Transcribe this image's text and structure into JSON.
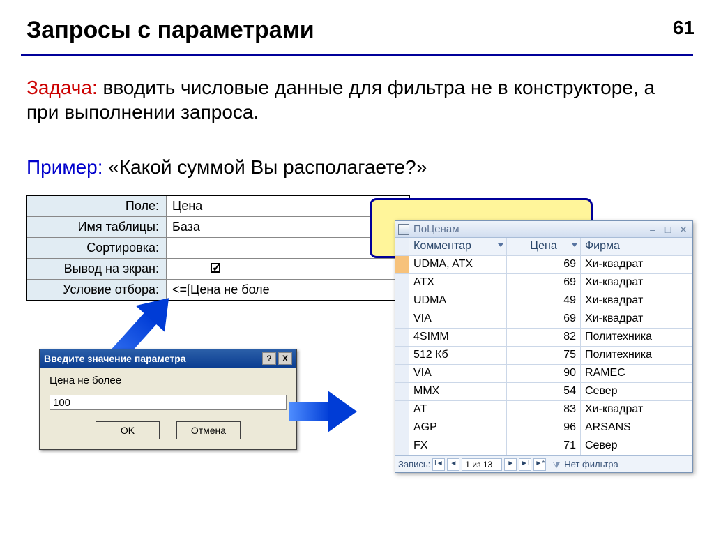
{
  "page_number": "61",
  "title": "Запросы с параметрами",
  "task_label": "Задача:",
  "task_text": " вводить числовые данные для фильтра не в конструкторе, а при выполнении запроса.",
  "example_label": "Пример:",
  "example_text": " «Какой суммой Вы располагаете?»",
  "query_grid": {
    "labels": {
      "field": "Поле:",
      "table": "Имя таблицы:",
      "sort": "Сортировка:",
      "show": "Вывод на экран:",
      "criteria": "Условие отбора:"
    },
    "values": {
      "field": "Цена",
      "table": "База",
      "sort": "",
      "criteria": "<=[Цена не боле"
    }
  },
  "dialog": {
    "title": "Введите значение параметра",
    "help_btn": "?",
    "close_btn": "X",
    "prompt": "Цена не более",
    "value": "100",
    "ok": "OK",
    "cancel": "Отмена"
  },
  "result": {
    "window_title": "ПоЦенам",
    "columns": [
      "Комментар",
      "Цена",
      "Фирма"
    ],
    "rows": [
      {
        "c1": "UDMA, ATX",
        "c2": "69",
        "c3": "Хи-квадрат"
      },
      {
        "c1": "ATX",
        "c2": "69",
        "c3": "Хи-квадрат"
      },
      {
        "c1": "UDMA",
        "c2": "49",
        "c3": "Хи-квадрат"
      },
      {
        "c1": "VIA",
        "c2": "69",
        "c3": "Хи-квадрат"
      },
      {
        "c1": "4SIMM",
        "c2": "82",
        "c3": "Политехника"
      },
      {
        "c1": "512 Кб",
        "c2": "75",
        "c3": "Политехника"
      },
      {
        "c1": "VIA",
        "c2": "90",
        "c3": "RAMEC"
      },
      {
        "c1": "MMX",
        "c2": "54",
        "c3": "Север"
      },
      {
        "c1": "AT",
        "c2": "83",
        "c3": "Хи-квадрат"
      },
      {
        "c1": "AGP",
        "c2": "96",
        "c3": "ARSANS"
      },
      {
        "c1": "FX",
        "c2": "71",
        "c3": "Север"
      }
    ],
    "nav": {
      "label": "Запись:",
      "position": "1 из 13",
      "no_filter": "Нет фильтра"
    }
  }
}
